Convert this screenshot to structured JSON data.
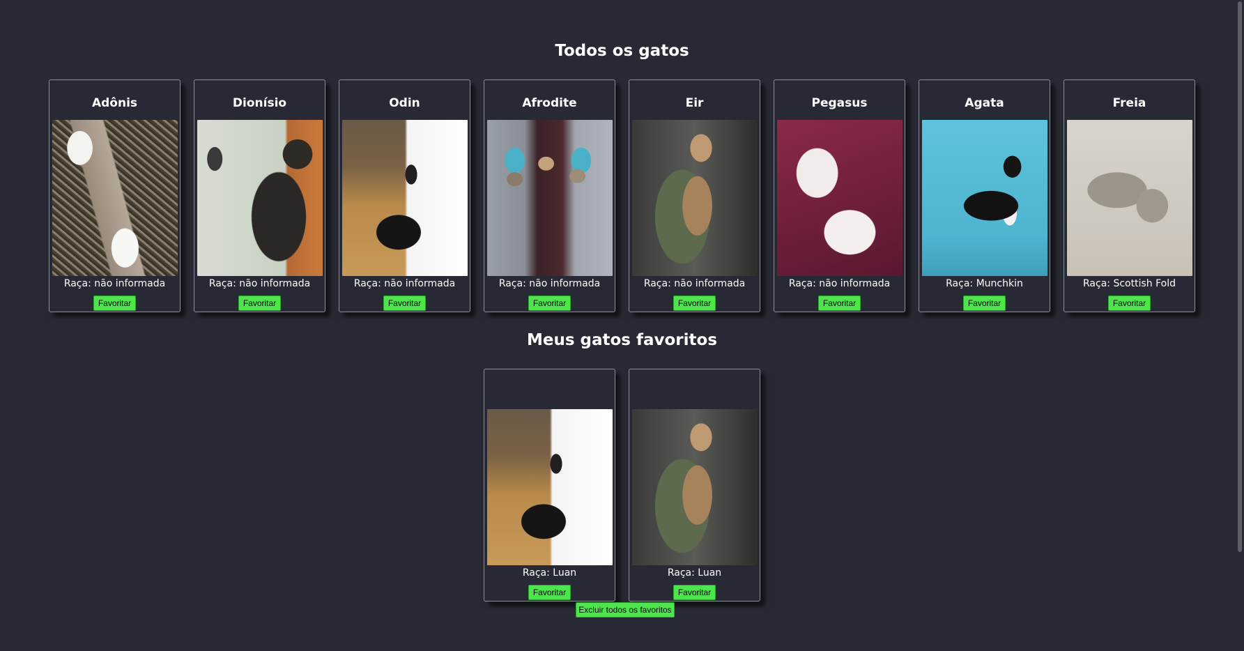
{
  "all_cats": {
    "title": "Todos os gatos",
    "cards": [
      {
        "name": "Adônis",
        "breed": "Raça: não informada",
        "button": "Favoritar",
        "image": "cat-paws-photo"
      },
      {
        "name": "Dionísio",
        "breed": "Raça: não informada",
        "button": "Favoritar",
        "image": "cat-and-bird-photo"
      },
      {
        "name": "Odin",
        "breed": "Raça: não informada",
        "button": "Favoritar",
        "image": "black-white-cat-jumping-photo"
      },
      {
        "name": "Afrodite",
        "breed": "Raça: não informada",
        "button": "Favoritar",
        "image": "kittens-in-hats-photo"
      },
      {
        "name": "Eir",
        "breed": "Raça: não informada",
        "button": "Favoritar",
        "image": "woman-holding-cat-photo"
      },
      {
        "name": "Pegasus",
        "breed": "Raça: não informada",
        "button": "Favoritar",
        "image": "two-white-cats-photo"
      },
      {
        "name": "Agata",
        "breed": "Raça: Munchkin",
        "button": "Favoritar",
        "image": "munchkin-cat-photo"
      },
      {
        "name": "Freia",
        "breed": "Raça: Scottish Fold",
        "button": "Favoritar",
        "image": "scottish-fold-cat-photo"
      }
    ]
  },
  "favorites": {
    "title": "Meus gatos favoritos",
    "cards": [
      {
        "name": "",
        "breed": "Raça: Luan",
        "button": "Favoritar",
        "image": "black-white-cat-jumping-photo"
      },
      {
        "name": "",
        "breed": "Raça: Luan",
        "button": "Favoritar",
        "image": "woman-holding-cat-photo"
      }
    ],
    "clear_button": "Excluir todos os favoritos"
  },
  "colors": {
    "background": "#272a34",
    "button": "#4ee44e",
    "card_border": "#8c8f96"
  }
}
